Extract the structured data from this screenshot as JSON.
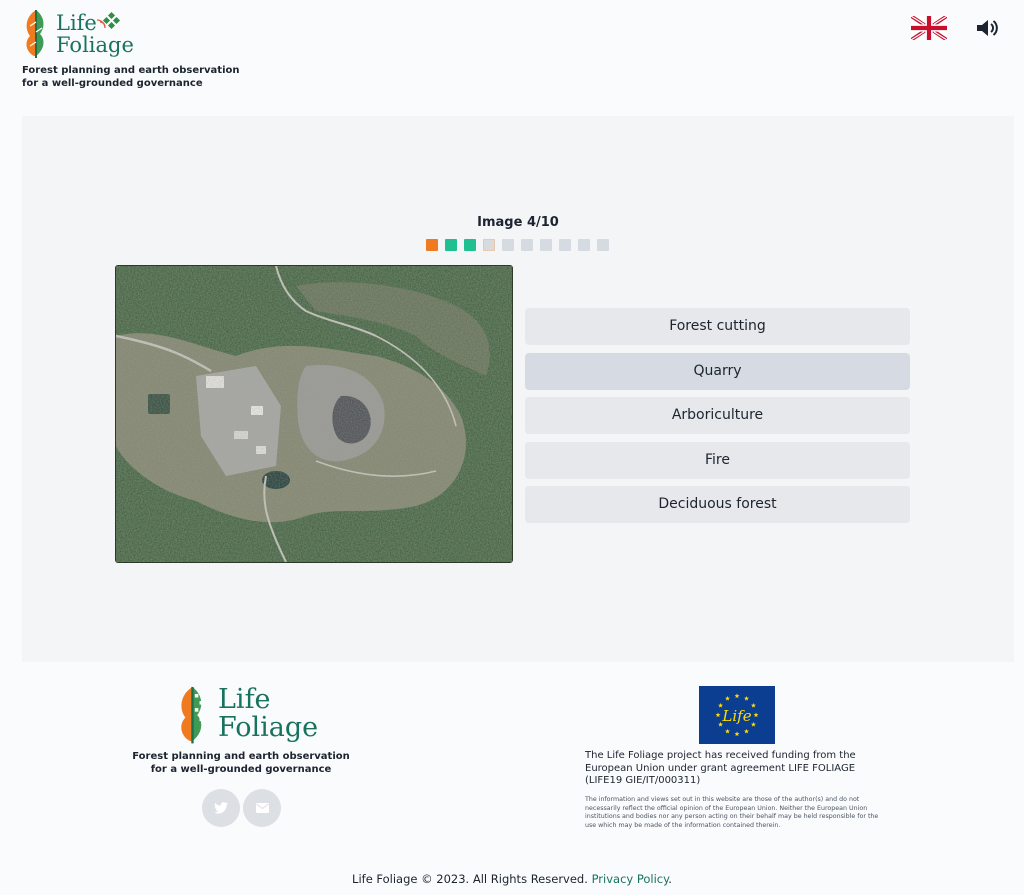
{
  "header": {
    "logo_line1": "Life",
    "logo_line2": "Foliage",
    "tagline_line1": "Forest planning and earth observation",
    "tagline_line2": "for a well-grounded governance"
  },
  "quiz": {
    "counter": "Image 4/10",
    "current": 4,
    "total": 10,
    "progress": [
      "wrong",
      "right",
      "right",
      "current",
      "pending",
      "pending",
      "pending",
      "pending",
      "pending",
      "pending"
    ],
    "answers": [
      {
        "label": "Forest cutting",
        "selected": false
      },
      {
        "label": "Quarry",
        "selected": true
      },
      {
        "label": "Arboriculture",
        "selected": false
      },
      {
        "label": "Fire",
        "selected": false
      },
      {
        "label": "Deciduous forest",
        "selected": false
      }
    ]
  },
  "footer": {
    "logo_line1": "Life",
    "logo_line2": "Foliage",
    "tagline_line1": "Forest planning and earth observation",
    "tagline_line2": "for a well-grounded governance",
    "eu_logo_text": "Life",
    "funding_text": "The Life Foliage project has received funding from the European Union under grant agreement LIFE FOLIAGE (LIFE19 GIE/IT/000311)",
    "disclaimer": "The information and views set out in this website are those of the author(s) and do not necessarily reflect the official opinion of the European Union. Neither the European Union institutions and bodies nor any person acting on their behalf may be held responsible for the use which may be made of the information contained therein.",
    "copyright_prefix": "Life Foliage © 2023. All Rights Reserved. ",
    "privacy_link": "Privacy Policy",
    "copyright_suffix": "."
  },
  "colors": {
    "brand_green": "#18735e",
    "progress_wrong": "#f07a1f",
    "progress_right": "#1fbf8f",
    "progress_pending": "#d6dbe1",
    "answer_bg": "#e6e8ec",
    "answer_selected_bg": "#d6dbe3"
  },
  "icons": [
    "uk-flag-icon",
    "sound-icon",
    "twitter-icon",
    "mail-icon",
    "eu-flag-icon",
    "leaf-logo-icon"
  ]
}
